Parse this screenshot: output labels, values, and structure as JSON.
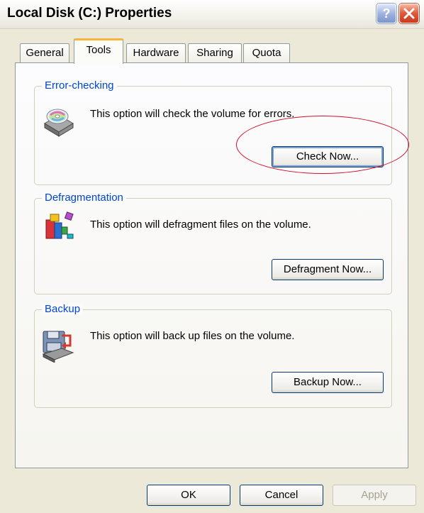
{
  "window": {
    "title": "Local Disk (C:) Properties",
    "help_button": "?",
    "close_button": "×"
  },
  "tabs": [
    {
      "label": "General"
    },
    {
      "label": "Tools",
      "active": true
    },
    {
      "label": "Hardware"
    },
    {
      "label": "Sharing"
    },
    {
      "label": "Quota"
    }
  ],
  "groups": {
    "error_checking": {
      "title": "Error-checking",
      "description": "This option will check the volume for errors.",
      "button": "Check Now...",
      "icon": "disk-check-icon"
    },
    "defragmentation": {
      "title": "Defragmentation",
      "description": "This option will defragment files on the volume.",
      "button": "Defragment Now...",
      "icon": "defragment-icon"
    },
    "backup": {
      "title": "Backup",
      "description": "This option will back up files on the volume.",
      "button": "Backup Now...",
      "icon": "backup-icon"
    }
  },
  "footer": {
    "ok": "OK",
    "cancel": "Cancel",
    "apply": "Apply"
  },
  "colors": {
    "dialog_bg": "#ece9d8",
    "group_title": "#0046d5",
    "active_tab_accent": "#f5b638",
    "annotation": "#d0102a"
  }
}
